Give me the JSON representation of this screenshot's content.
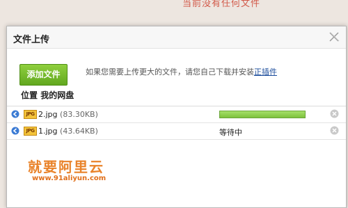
{
  "background": {
    "text": "当前没有任何文件"
  },
  "dialog": {
    "title": "文件上传",
    "add_button": "添加文件",
    "hint_text": "如果您需要上传更大的文件，请您自己下载并安装",
    "hint_link": "正插件",
    "location_label": "位置",
    "location_value": "我的网盘"
  },
  "files": [
    {
      "name": "2.jpg",
      "size": "(83.30KB)",
      "badge": "JPG",
      "progress": 1.0,
      "status": ""
    },
    {
      "name": "1.jpg",
      "size": "(43.64KB)",
      "badge": "JPG",
      "progress": null,
      "status": "等待中"
    }
  ],
  "watermark": {
    "line1": "就要阿里云",
    "line2": "www.91aliyun.com"
  },
  "colors": {
    "button": "#62a81f",
    "progress": "#7dc23d",
    "link": "#1a4b9b"
  }
}
